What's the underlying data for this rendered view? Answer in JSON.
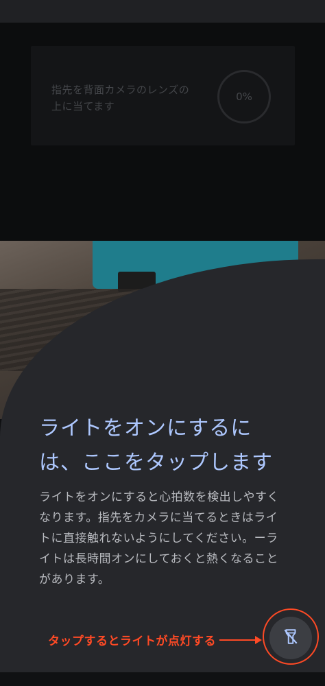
{
  "pulse": {
    "instruction": "指先を背面カメラのレンズの上に当てます",
    "progress": "0%"
  },
  "hint": {
    "title": "ライトをオンにするには、ここをタップします",
    "body": "ライトをオンにすると心拍数を検出しやすくなります。指先をカメラに当てるときはライトに直接触れないようにしてください。ーライトは長時間オンにしておくと熱くなることがあります。"
  },
  "annotation": {
    "text": "タップするとライトが点灯する"
  },
  "icons": {
    "flash": "flashlight-off-icon"
  },
  "colors": {
    "accent": "#aec8ff",
    "annotation": "#ff4a25"
  }
}
